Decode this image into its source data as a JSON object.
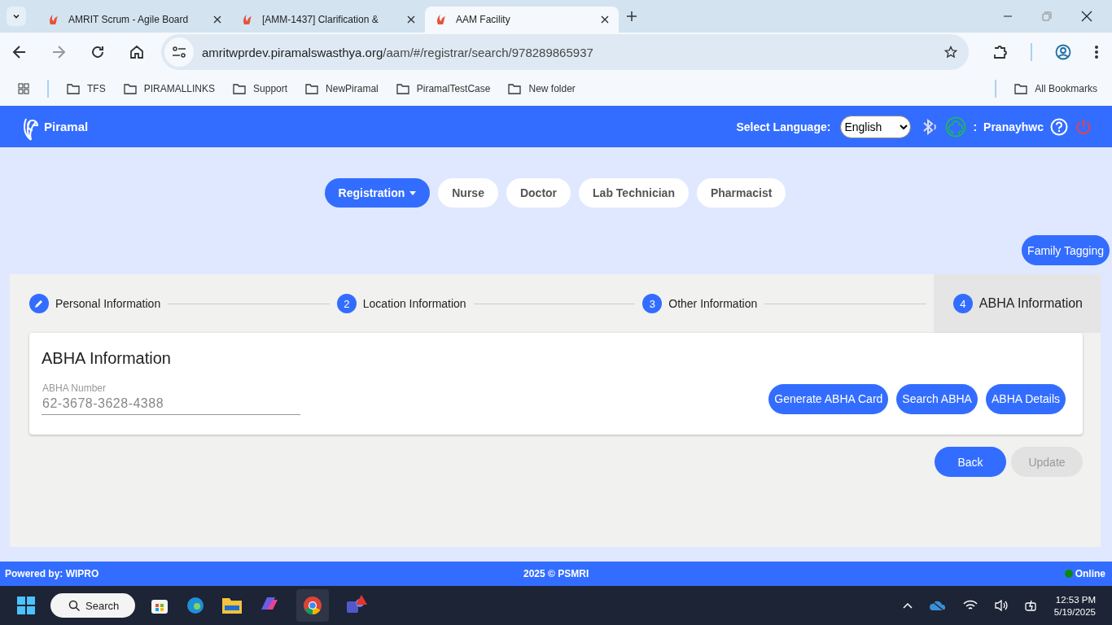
{
  "browser": {
    "tabs": [
      {
        "title": "AMRIT Scrum - Agile Board",
        "selected": false
      },
      {
        "title": "[AMM-1437] Clarification &",
        "selected": false
      },
      {
        "title": "AAM Facility",
        "selected": true
      }
    ],
    "url_host": "amritwprdev.piramalswasthya.org",
    "url_path": "/aam/#/registrar/search/978289865937",
    "bookmarks": [
      "TFS",
      "PIRAMALLINKS",
      "Support",
      "NewPiramal",
      "PiramalTestCase",
      "New folder"
    ],
    "all_bookmarks": "All Bookmarks"
  },
  "header": {
    "logo": "Piramal",
    "language_label": "Select Language:",
    "language": "English",
    "user_separator": ":",
    "user": "Pranayhwc"
  },
  "roles": [
    {
      "label": "Registration",
      "selected": true,
      "dropdown": true
    },
    {
      "label": "Nurse",
      "selected": false,
      "dropdown": false
    },
    {
      "label": "Doctor",
      "selected": false,
      "dropdown": false
    },
    {
      "label": "Lab Technician",
      "selected": false,
      "dropdown": false
    },
    {
      "label": "Pharmacist",
      "selected": false,
      "dropdown": false
    }
  ],
  "family_tagging": "Family Tagging",
  "steps": [
    {
      "kind": "edit",
      "label": "Personal Information",
      "selected": false
    },
    {
      "marker": "2",
      "kind": "number",
      "label": "Location Information",
      "selected": false
    },
    {
      "marker": "3",
      "kind": "number",
      "label": "Other Information",
      "selected": false
    },
    {
      "marker": "4",
      "kind": "number",
      "label": "ABHA Information",
      "selected": true
    }
  ],
  "card": {
    "title": "ABHA Information",
    "field_label": "ABHA Number",
    "field_value": "62-3678-3628-4388",
    "buttons": [
      "Generate ABHA Card",
      "Search ABHA",
      "ABHA Details"
    ]
  },
  "actions": [
    {
      "label": "Back",
      "disabled": false
    },
    {
      "label": "Update",
      "disabled": true
    }
  ],
  "footer": {
    "left": "Powered by: WIPRO",
    "center": "2025 © PSMRI",
    "status": "Online",
    "online": true
  },
  "taskbar": {
    "search": "Search",
    "time": "12:53 PM",
    "date": "5/19/2025"
  }
}
